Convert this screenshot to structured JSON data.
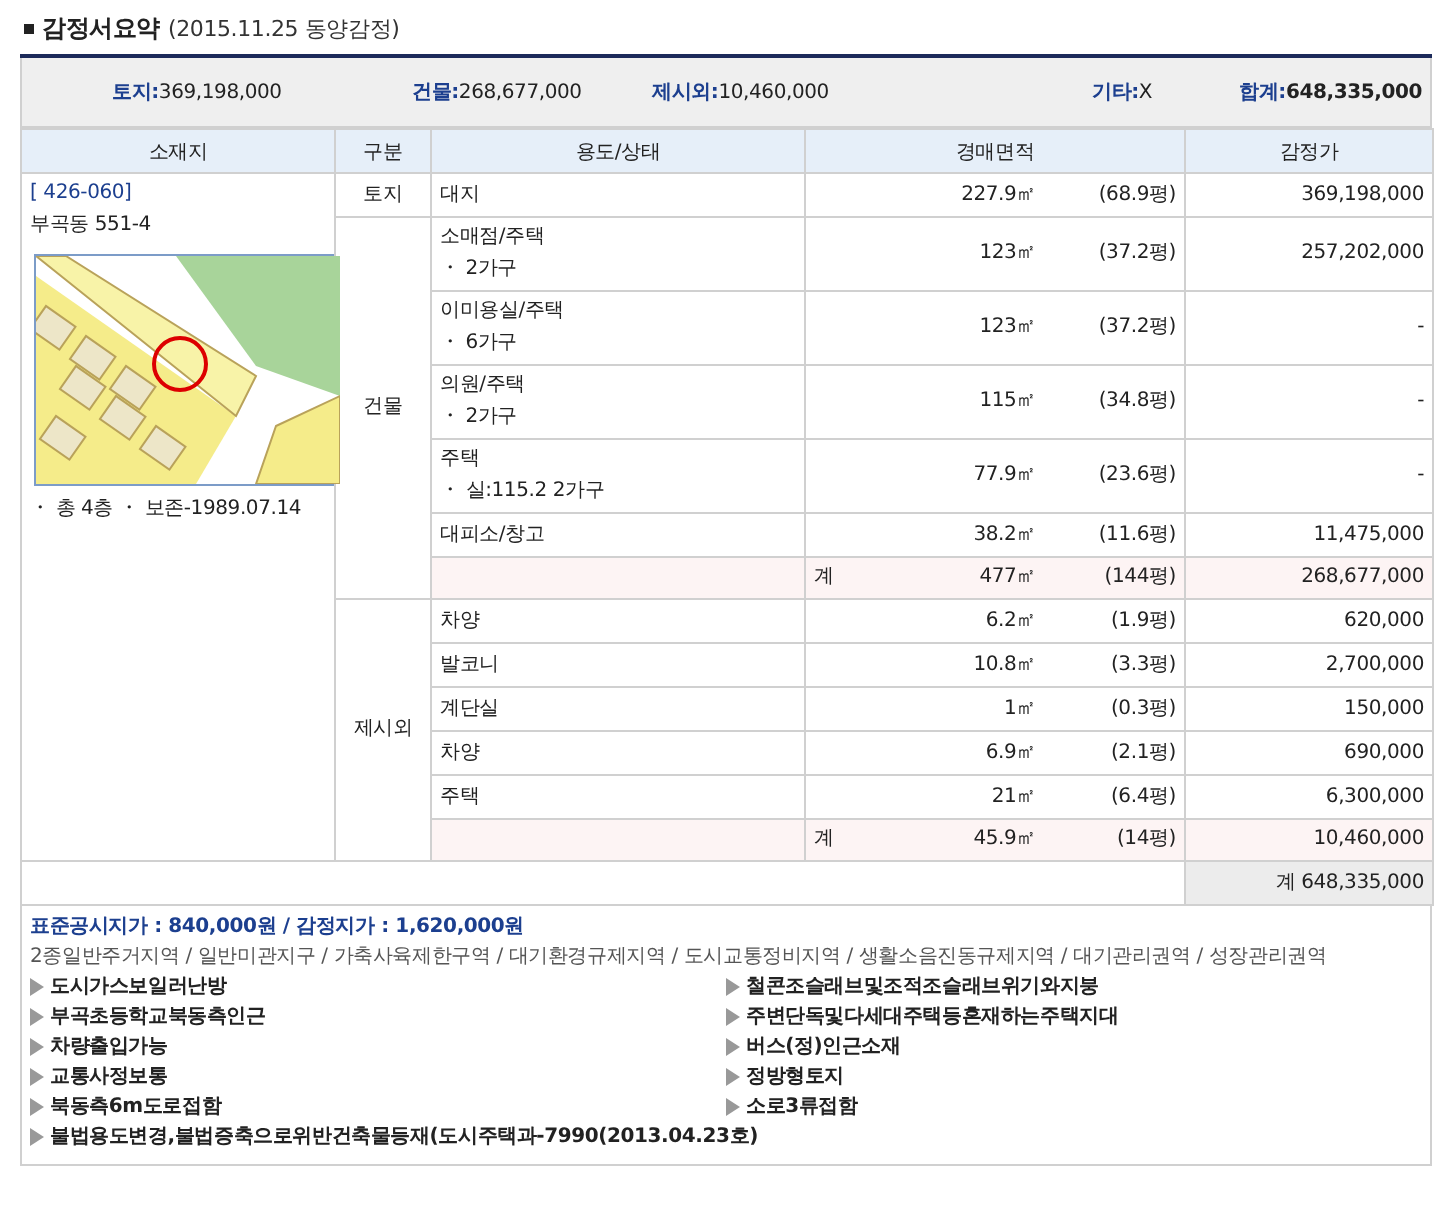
{
  "title": "감정서요약",
  "title_note": "(2015.11.25  동양감정)",
  "summary": [
    {
      "label": "토지:",
      "value": "369,198,000",
      "emphasis": false
    },
    {
      "label": "건물:",
      "value": "268,677,000",
      "emphasis": false
    },
    {
      "label": "제시외:",
      "value": "10,460,000",
      "emphasis": false
    },
    {
      "label": "기타:",
      "value": "X",
      "emphasis": false
    },
    {
      "label": "합계:",
      "value": "648,335,000",
      "emphasis": true
    }
  ],
  "columns": [
    "소재지",
    "구분",
    "용도/상태",
    "경매면적",
    "감정가"
  ],
  "location": {
    "code": "[ 426-060]",
    "address": "부곡동 551-4",
    "notes": [
      "・ 총 4층",
      "・ 보존-1989.07.14"
    ]
  },
  "groups": [
    {
      "category": "토지",
      "rows": [
        {
          "use": "대지",
          "area": "227.9㎡",
          "pyeong": "(68.9평)",
          "price": "369,198,000"
        }
      ]
    },
    {
      "category": "건물",
      "rows": [
        {
          "use": "소매점/주택",
          "detail": "・ 2가구",
          "area": "123㎡",
          "pyeong": "(37.2평)",
          "price": "257,202,000"
        },
        {
          "use": "이미용실/주택",
          "detail": "・ 6가구",
          "area": "123㎡",
          "pyeong": "(37.2평)",
          "price": "-"
        },
        {
          "use": "의원/주택",
          "detail": "・ 2가구",
          "area": "115㎡",
          "pyeong": "(34.8평)",
          "price": "-"
        },
        {
          "use": "주택",
          "detail": "・ 실:115.2 2가구",
          "area": "77.9㎡",
          "pyeong": "(23.6평)",
          "price": "-"
        },
        {
          "use": "대피소/창고",
          "area": "38.2㎡",
          "pyeong": "(11.6평)",
          "price": "11,475,000"
        }
      ],
      "subtotal": {
        "label": "계",
        "area": "477㎡",
        "pyeong": "(144평)",
        "price": "268,677,000"
      }
    },
    {
      "category": "제시외",
      "rows": [
        {
          "use": "차양",
          "area": "6.2㎡",
          "pyeong": "(1.9평)",
          "price": "620,000"
        },
        {
          "use": "발코니",
          "area": "10.8㎡",
          "pyeong": "(3.3평)",
          "price": "2,700,000"
        },
        {
          "use": "계단실",
          "area": "1㎡",
          "pyeong": "(0.3평)",
          "price": "150,000"
        },
        {
          "use": "차양",
          "area": "6.9㎡",
          "pyeong": "(2.1평)",
          "price": "690,000"
        },
        {
          "use": "주택",
          "area": "21㎡",
          "pyeong": "(6.4평)",
          "price": "6,300,000"
        }
      ],
      "subtotal": {
        "label": "계",
        "area": "45.9㎡",
        "pyeong": "(14평)",
        "price": "10,460,000"
      }
    }
  ],
  "total": {
    "label": "계",
    "value": "648,335,000"
  },
  "remarks": {
    "price_line": "표준공시지가 : 840,000원 / 감정지가 : 1,620,000원",
    "zones": "2종일반주거지역 / 일반미관지구 / 가축사육제한구역 / 대기환경규제지역 / 도시교통정비지역 / 생활소음진동규제지역 / 대기관리권역 / 성장관리권역",
    "features": [
      "도시가스보일러난방",
      "철콘조슬래브및조적조슬래브위기와지붕",
      "부곡초등학교북동측인근",
      "주변단독및다세대주택등혼재하는주택지대",
      "차량출입가능",
      "버스(정)인근소재",
      "교통사정보통",
      "정방형토지",
      "북동측6m도로접함",
      "소로3류접함"
    ],
    "wide_feature": "불법용도변경,불법증축으로위반건축물등재(도시주택과-7990(2013.04.23호)"
  }
}
